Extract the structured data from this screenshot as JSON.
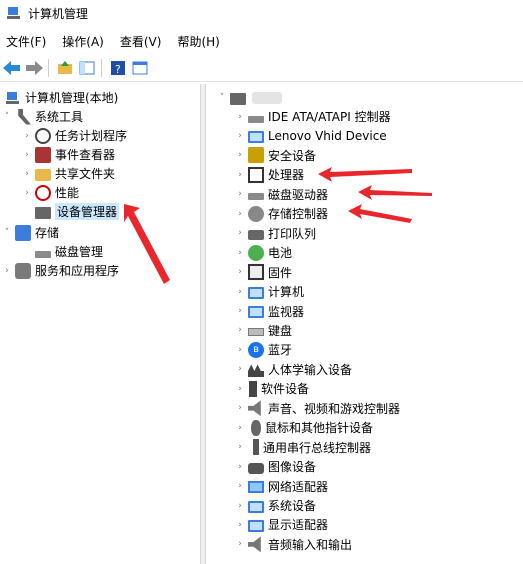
{
  "window": {
    "title": "计算机管理"
  },
  "menus": [
    "文件(F)",
    "操作(A)",
    "查看(V)",
    "帮助(H)"
  ],
  "left_tree": [
    {
      "label": "计算机管理(本地)",
      "chev": "",
      "icon": "computer-management-icon",
      "indent": 0
    },
    {
      "label": "系统工具",
      "chev": "˅",
      "icon": "tools-icon",
      "indent": 1
    },
    {
      "label": "任务计划程序",
      "chev": "›",
      "icon": "clock-icon",
      "indent": 2
    },
    {
      "label": "事件查看器",
      "chev": "›",
      "icon": "event-viewer-icon",
      "indent": 2
    },
    {
      "label": "共享文件夹",
      "chev": "›",
      "icon": "shared-folder-icon",
      "indent": 2
    },
    {
      "label": "性能",
      "chev": "›",
      "icon": "performance-icon",
      "indent": 2
    },
    {
      "label": "设备管理器",
      "chev": "",
      "icon": "device-manager-icon",
      "indent": 2,
      "selected": true
    },
    {
      "label": "存储",
      "chev": "˅",
      "icon": "storage-icon",
      "indent": 1
    },
    {
      "label": "磁盘管理",
      "chev": "",
      "icon": "disk-management-icon",
      "indent": 2
    },
    {
      "label": "服务和应用程序",
      "chev": "›",
      "icon": "services-icon",
      "indent": 1
    }
  ],
  "device_tree": [
    {
      "label": "IDE ATA/ATAPI 控制器",
      "icon": "ide-controller-icon"
    },
    {
      "label": "Lenovo Vhid Device",
      "icon": "lenovo-device-icon"
    },
    {
      "label": "安全设备",
      "icon": "security-device-icon"
    },
    {
      "label": "处理器",
      "icon": "processor-icon"
    },
    {
      "label": "磁盘驱动器",
      "icon": "disk-drive-icon"
    },
    {
      "label": "存储控制器",
      "icon": "storage-controller-icon"
    },
    {
      "label": "打印队列",
      "icon": "print-queue-icon"
    },
    {
      "label": "电池",
      "icon": "battery-icon"
    },
    {
      "label": "固件",
      "icon": "firmware-icon"
    },
    {
      "label": "计算机",
      "icon": "computer-icon"
    },
    {
      "label": "监视器",
      "icon": "monitor-icon"
    },
    {
      "label": "键盘",
      "icon": "keyboard-icon"
    },
    {
      "label": "蓝牙",
      "icon": "bluetooth-icon"
    },
    {
      "label": "人体学输入设备",
      "icon": "hid-icon"
    },
    {
      "label": "软件设备",
      "icon": "software-device-icon"
    },
    {
      "label": "声音、视频和游戏控制器",
      "icon": "audio-icon"
    },
    {
      "label": "鼠标和其他指针设备",
      "icon": "mouse-icon"
    },
    {
      "label": "通用串行总线控制器",
      "icon": "usb-icon"
    },
    {
      "label": "图像设备",
      "icon": "camera-icon"
    },
    {
      "label": "网络适配器",
      "icon": "network-adapter-icon"
    },
    {
      "label": "系统设备",
      "icon": "system-device-icon"
    },
    {
      "label": "显示适配器",
      "icon": "display-adapter-icon"
    },
    {
      "label": "音频输入和输出",
      "icon": "audio-io-icon"
    }
  ],
  "colors": {
    "arrow": "#e8262b",
    "selection": "#cce8ff"
  }
}
